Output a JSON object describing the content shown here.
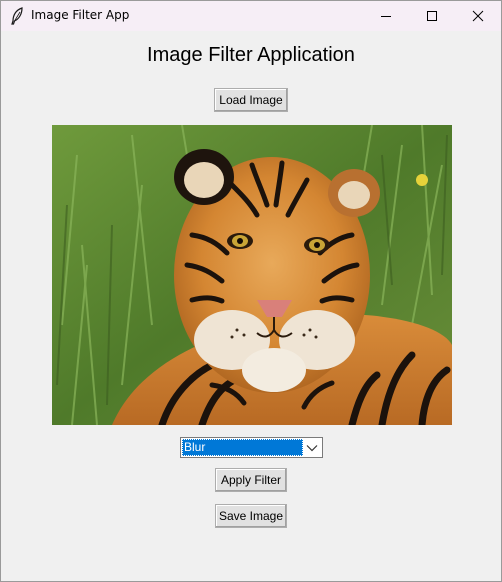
{
  "window": {
    "title": "Image Filter App",
    "icon": "feather-icon",
    "controls": [
      "minimize-icon",
      "maximize-icon",
      "close-icon"
    ]
  },
  "main": {
    "heading": "Image Filter Application",
    "load_button_label": "Load Image",
    "image": {
      "subject": "tiger-image"
    },
    "filter_select": {
      "selected": "Blur",
      "icon": "chevron-down-icon"
    },
    "apply_button_label": "Apply Filter",
    "save_button_label": "Save Image"
  },
  "colors": {
    "titlebar": "#f6eef6",
    "window_bg": "#f0f0f0",
    "selection": "#0078d7",
    "button_bg": "#e1e1e1"
  }
}
